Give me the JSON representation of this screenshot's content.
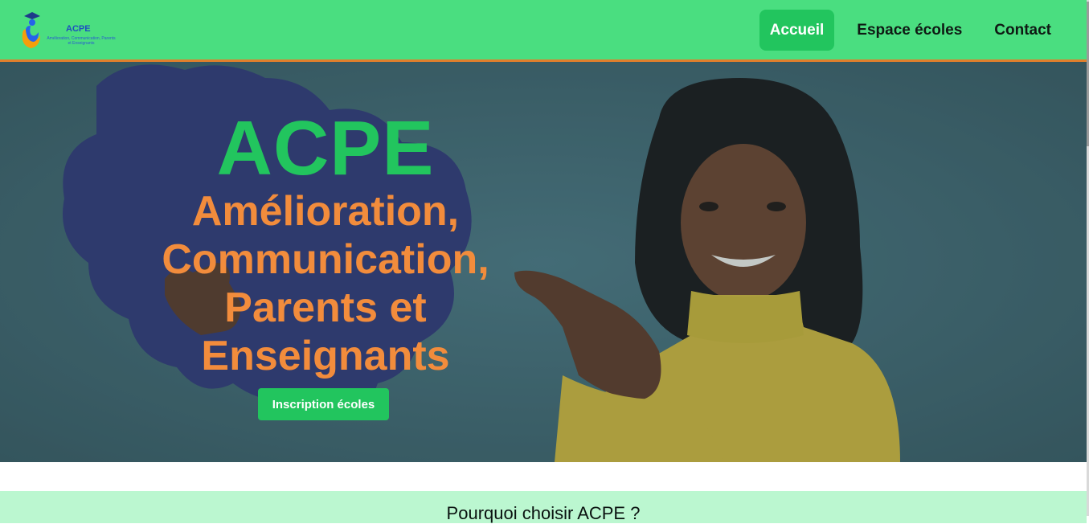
{
  "header": {
    "logo": {
      "title": "ACPE",
      "subtitle": "Amélioration, Communication, Parents et Enseignants"
    },
    "nav": [
      {
        "label": "Accueil",
        "active": true
      },
      {
        "label": "Espace écoles",
        "active": false
      },
      {
        "label": "Contact",
        "active": false
      }
    ]
  },
  "hero": {
    "title": "ACPE",
    "subtitle": "Amélioration, Communication, Parents et Enseignants",
    "cta_label": "Inscription écoles"
  },
  "why_section": {
    "title": "Pourquoi choisir ACPE ?"
  },
  "colors": {
    "navbar": "#4ade80",
    "accent_green": "#22c55e",
    "accent_orange": "#f28c3c",
    "section_bg": "#bbf7d0"
  }
}
